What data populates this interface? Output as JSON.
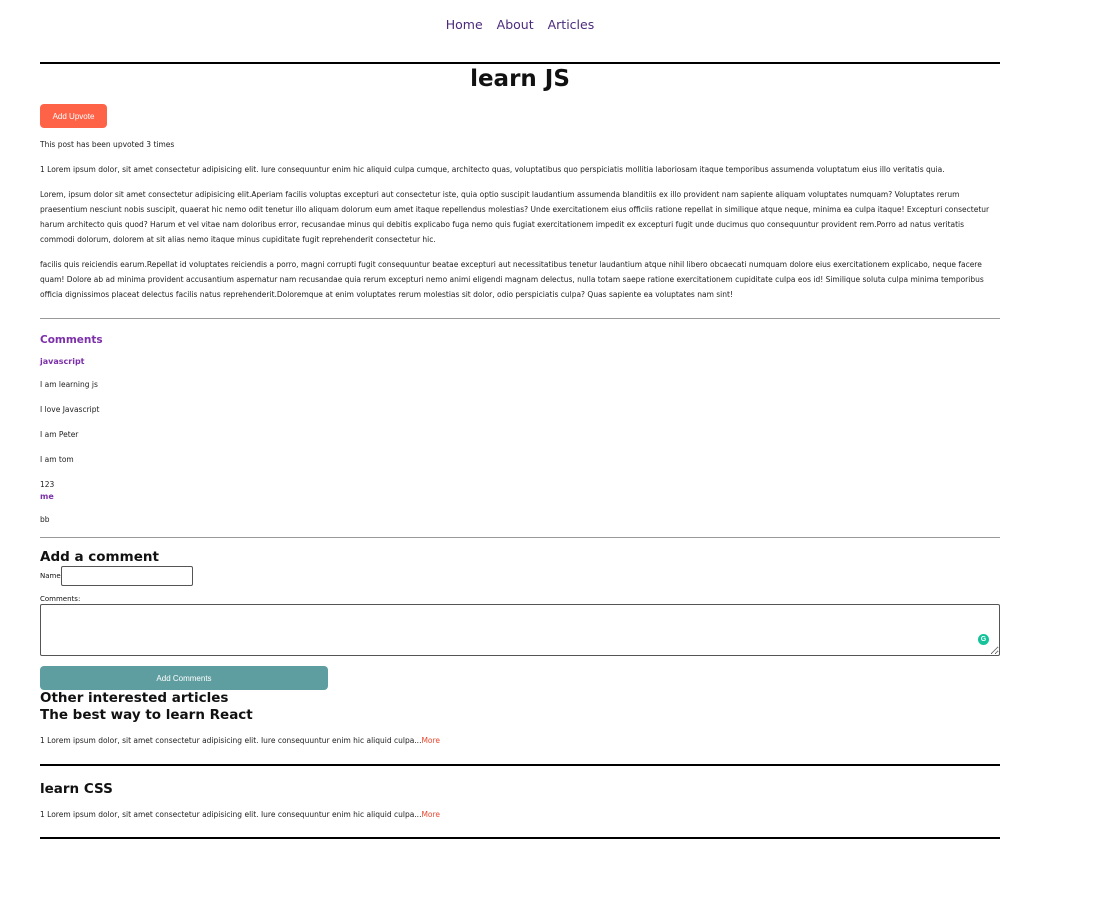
{
  "nav": {
    "items": [
      "Home",
      "About",
      "Articles"
    ]
  },
  "article": {
    "title": "learn JS",
    "upvote_button": "Add Upvote",
    "upvote_text": "This post has been upvoted 3 times",
    "paragraphs": [
      "1 Lorem ipsum dolor, sit amet consectetur adipisicing elit. Iure consequuntur enim hic aliquid culpa cumque, architecto quas, voluptatibus quo perspiciatis mollitia laboriosam itaque temporibus assumenda voluptatum eius illo veritatis quia.",
      "Lorem, ipsum dolor sit amet consectetur adipisicing elit.Aperiam facilis voluptas excepturi aut consectetur iste, quia optio suscipit laudantium assumenda blanditiis ex illo provident nam sapiente aliquam voluptates numquam? Voluptates rerum praesentium nesciunt nobis suscipit, quaerat hic nemo odit tenetur illo aliquam dolorum eum amet itaque repellendus molestias? Unde exercitationem eius officiis ratione repellat in similique atque neque, minima ea culpa itaque! Excepturi consectetur harum architecto quis quod? Harum et vel vitae nam doloribus error, recusandae minus qui debitis explicabo fuga nemo quis fugiat exercitationem impedit ex excepturi fugit unde ducimus quo consequuntur provident rem.Porro ad natus veritatis commodi dolorum, dolorem at sit alias nemo itaque minus cupiditate fugit reprehenderit consectetur hic.",
      "facilis quis reiciendis earum.Repellat id voluptates reiciendis a porro, magni corrupti fugit consequuntur beatae excepturi aut necessitatibus tenetur laudantium atque nihil libero obcaecati numquam dolore eius exercitationem explicabo, neque facere quam! Dolore ab ad minima provident accusantium aspernatur nam recusandae quia rerum excepturi nemo animi eligendi magnam delectus, nulla totam saepe ratione exercitationem cupiditate culpa eos id! Similique soluta culpa minima temporibus officia dignissimos placeat delectus facilis natus reprehenderit.Doloremque at enim voluptates rerum molestias sit dolor, odio perspiciatis culpa? Quas sapiente ea voluptates nam sint!"
    ]
  },
  "comments": {
    "heading": "Comments",
    "items": [
      {
        "author": "javascript",
        "text": "I am learning js"
      },
      {
        "author": "",
        "text": "I love Javascript"
      },
      {
        "author": "",
        "text": "I am Peter"
      },
      {
        "author": "",
        "text": "I am tom"
      },
      {
        "author": "",
        "text": "123"
      },
      {
        "author": "me",
        "text": "bb"
      }
    ]
  },
  "add_comment": {
    "heading": "Add a comment",
    "name_label": "Name:",
    "name_value": "",
    "comments_label": "Comments:",
    "comments_value": "",
    "submit_label": "Add Comments",
    "grammarly_glyph": "G"
  },
  "other_articles": {
    "heading": "Other interested articles",
    "items": [
      {
        "title": "The best way to learn React",
        "excerpt": "1 Lorem ipsum dolor, sit amet consectetur adipisicing elit. Iure consequuntur enim hic aliquid culpa...",
        "more": "More"
      },
      {
        "title": "learn CSS",
        "excerpt": "1 Lorem ipsum dolor, sit amet consectetur adipisicing elit. Iure consequuntur enim hic aliquid culpa...",
        "more": "More"
      }
    ]
  },
  "colors": {
    "upvote_button": "#ff6347",
    "submit_button": "#5f9ea0",
    "nav_link": "#4b2a7b",
    "comment_accent": "#7b2fa8",
    "more_link": "#e8472f"
  }
}
